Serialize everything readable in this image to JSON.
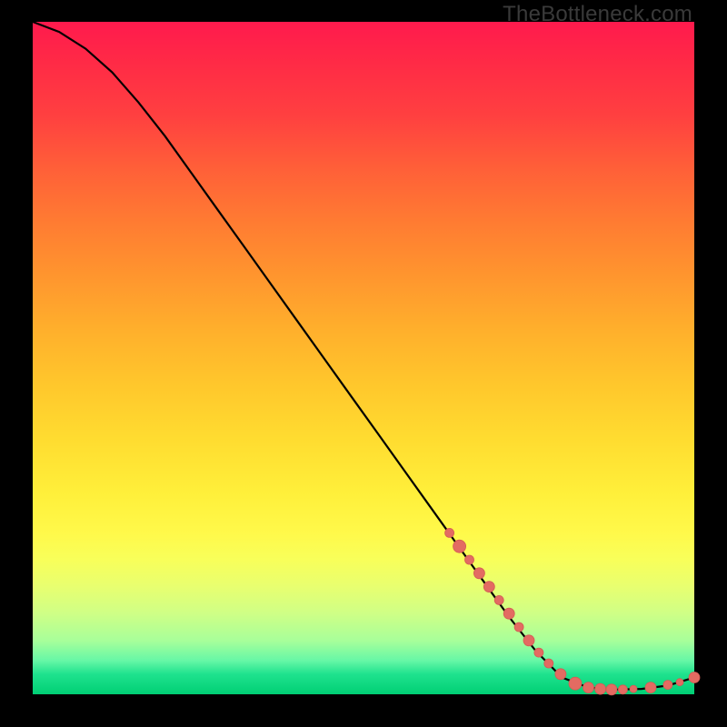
{
  "watermark": "TheBottleneck.com",
  "colors": {
    "background": "#000000",
    "line": "#000000",
    "dot_fill": "#e36b62",
    "dot_stroke": "#d45a54"
  },
  "chart_data": {
    "type": "line",
    "title": "",
    "xlabel": "",
    "ylabel": "",
    "xlim": [
      0,
      100
    ],
    "ylim": [
      0,
      100
    ],
    "grid": false,
    "legend": false,
    "series": [
      {
        "name": "curve",
        "x": [
          0,
          4,
          8,
          12,
          16,
          20,
          24,
          28,
          32,
          36,
          40,
          44,
          48,
          52,
          56,
          60,
          64,
          68,
          72,
          76,
          80,
          84,
          88,
          92,
          96,
          100
        ],
        "y": [
          100,
          98.5,
          96.0,
          92.5,
          88.0,
          83.0,
          77.5,
          72.0,
          66.5,
          61.0,
          55.5,
          50.0,
          44.5,
          39.0,
          33.5,
          28.0,
          22.5,
          17.0,
          11.5,
          6.5,
          2.5,
          1.0,
          0.7,
          0.8,
          1.3,
          2.5
        ]
      }
    ],
    "scatter": {
      "name": "dots",
      "points": [
        {
          "x": 63,
          "y": 24.0,
          "r": 5
        },
        {
          "x": 64.5,
          "y": 22.0,
          "r": 7
        },
        {
          "x": 66,
          "y": 20.0,
          "r": 5
        },
        {
          "x": 67.5,
          "y": 18.0,
          "r": 6
        },
        {
          "x": 69,
          "y": 16.0,
          "r": 6
        },
        {
          "x": 70.5,
          "y": 14.0,
          "r": 5
        },
        {
          "x": 72,
          "y": 12.0,
          "r": 6
        },
        {
          "x": 73.5,
          "y": 10.0,
          "r": 5
        },
        {
          "x": 75,
          "y": 8.0,
          "r": 6
        },
        {
          "x": 76.5,
          "y": 6.2,
          "r": 5
        },
        {
          "x": 78,
          "y": 4.6,
          "r": 5
        },
        {
          "x": 79.8,
          "y": 3.0,
          "r": 6
        },
        {
          "x": 82,
          "y": 1.6,
          "r": 7
        },
        {
          "x": 84,
          "y": 1.0,
          "r": 6
        },
        {
          "x": 85.8,
          "y": 0.8,
          "r": 6
        },
        {
          "x": 87.5,
          "y": 0.7,
          "r": 6
        },
        {
          "x": 89.2,
          "y": 0.7,
          "r": 5
        },
        {
          "x": 90.8,
          "y": 0.8,
          "r": 4
        },
        {
          "x": 93.4,
          "y": 1.0,
          "r": 6
        },
        {
          "x": 96.0,
          "y": 1.4,
          "r": 5
        },
        {
          "x": 97.8,
          "y": 1.8,
          "r": 4
        },
        {
          "x": 100,
          "y": 2.5,
          "r": 6
        }
      ]
    }
  }
}
